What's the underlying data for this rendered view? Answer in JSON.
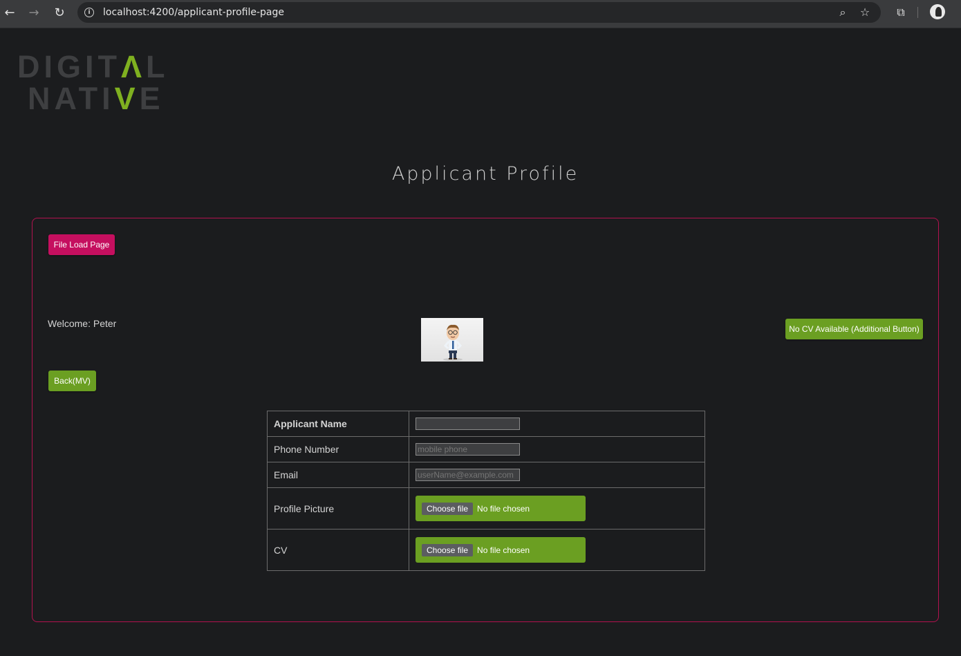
{
  "browser": {
    "url": "localhost:4200/applicant-profile-page"
  },
  "logo": {
    "line1": "DIGITAL",
    "line2": "NATIVE",
    "accent_color": "#7fb020"
  },
  "page": {
    "title": "Applicant Profile"
  },
  "buttons": {
    "file_load": "File Load Page",
    "no_cv": "No CV Available (Additional Button)",
    "back": "Back(MV)"
  },
  "welcome": "Welcome: Peter",
  "form": {
    "rows": [
      {
        "label": "Applicant Name",
        "value": "",
        "placeholder": ""
      },
      {
        "label": "Phone Number",
        "value": "",
        "placeholder": "mobile phone"
      },
      {
        "label": "Email",
        "value": "",
        "placeholder": "userName@example.com"
      },
      {
        "label": "Profile Picture",
        "button": "Choose file",
        "status": "No file chosen"
      },
      {
        "label": "CV",
        "button": "Choose file",
        "status": "No file chosen"
      }
    ]
  },
  "colors": {
    "panel_border": "#b3124f",
    "primary_pink": "#c50f5f",
    "green": "#6b9f22",
    "background": "#1b1c1e"
  }
}
